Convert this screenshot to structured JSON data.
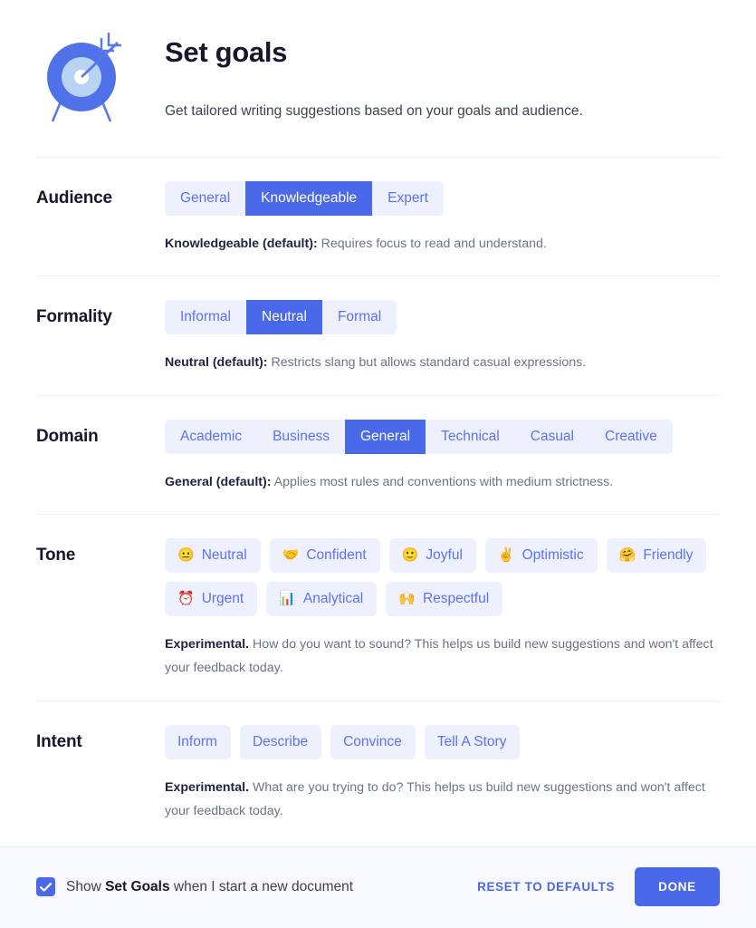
{
  "header": {
    "icon": "target-goal-icon",
    "title": "Set goals",
    "subtitle": "Get tailored writing suggestions based on your goals and audience."
  },
  "colors": {
    "accent": "#4a68ea",
    "chip_background": "#eff0fd",
    "chip_text": "#5a73f0",
    "divider": "#eef0f5",
    "footer_background": "#f8f9fe",
    "heading": "#17182b",
    "helper_text": "#6b7385"
  },
  "sections": [
    {
      "label": "Audience",
      "type": "segmented",
      "options": [
        "General",
        "Knowledgeable",
        "Expert"
      ],
      "selected": "Knowledgeable",
      "helper_strong": "Knowledgeable (default):",
      "helper_text": " Requires focus to read and understand."
    },
    {
      "label": "Formality",
      "type": "segmented",
      "options": [
        "Informal",
        "Neutral",
        "Formal"
      ],
      "selected": "Neutral",
      "helper_strong": "Neutral (default):",
      "helper_text": " Restricts slang but allows standard casual expressions."
    },
    {
      "label": "Domain",
      "type": "segmented",
      "options": [
        "Academic",
        "Business",
        "General",
        "Technical",
        "Casual",
        "Creative"
      ],
      "selected": "General",
      "helper_strong": "General (default):",
      "helper_text": " Applies most rules and conventions with medium strictness."
    },
    {
      "label": "Tone",
      "type": "chips",
      "chips": [
        {
          "emoji": "😐",
          "icon": "neutral-face-emoji",
          "label": "Neutral"
        },
        {
          "emoji": "🤝",
          "icon": "handshake-emoji",
          "label": "Confident"
        },
        {
          "emoji": "🙂",
          "icon": "slightly-smiling-face-emoji",
          "label": "Joyful"
        },
        {
          "emoji": "✌️",
          "icon": "victory-hand-emoji",
          "label": "Optimistic"
        },
        {
          "emoji": "🤗",
          "icon": "hugging-face-emoji",
          "label": "Friendly"
        },
        {
          "emoji": "⏰",
          "icon": "alarm-clock-emoji",
          "label": "Urgent"
        },
        {
          "emoji": "📊",
          "icon": "bar-chart-emoji",
          "label": "Analytical"
        },
        {
          "emoji": "🙌",
          "icon": "raising-hands-emoji",
          "label": "Respectful"
        }
      ],
      "selected": null,
      "helper_strong": "Experimental.",
      "helper_text": " How do you want to sound? This helps us build new suggestions and won't affect your feedback today."
    },
    {
      "label": "Intent",
      "type": "chips",
      "chips": [
        {
          "emoji": "",
          "icon": "",
          "label": "Inform"
        },
        {
          "emoji": "",
          "icon": "",
          "label": "Describe"
        },
        {
          "emoji": "",
          "icon": "",
          "label": "Convince"
        },
        {
          "emoji": "",
          "icon": "",
          "label": "Tell A Story"
        }
      ],
      "selected": null,
      "helper_strong": "Experimental.",
      "helper_text": " What are you trying to do? This helps us build new suggestions and won't affect your feedback today."
    }
  ],
  "footer": {
    "checkbox_checked": true,
    "checkbox_prefix": "Show ",
    "checkbox_strong": "Set Goals",
    "checkbox_suffix": " when I start a new document",
    "reset_label": "RESET TO DEFAULTS",
    "done_label": "DONE"
  }
}
